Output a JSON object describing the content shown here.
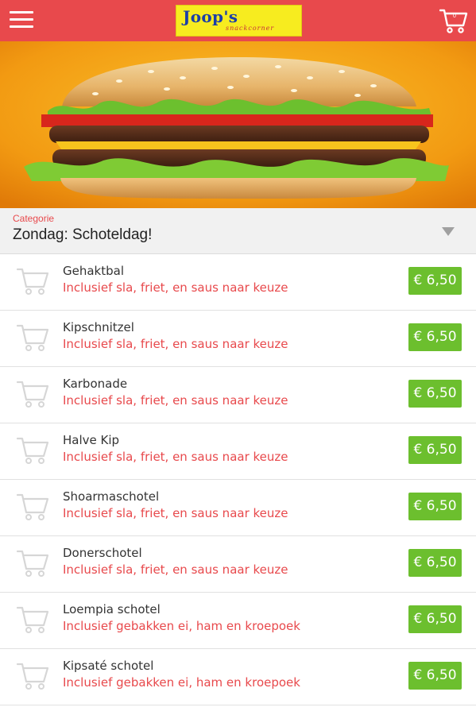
{
  "header": {
    "menu_icon": "hamburger-menu-icon",
    "logo": {
      "name": "Joop's",
      "tagline": "snackcorner"
    },
    "cart": {
      "icon": "shopping-cart-icon",
      "count": "0"
    }
  },
  "colors": {
    "header_bg": "#e8494c",
    "accent_red": "#e8494c",
    "price_green": "#6cbf2e",
    "logo_yellow": "#f7ec1f",
    "logo_blue": "#1b3fa8"
  },
  "hero": {
    "image": "burger-photo"
  },
  "category": {
    "label": "Categorie",
    "selected": "Zondag: Schoteldag!",
    "dropdown_icon": "triangle-down-icon"
  },
  "products": [
    {
      "name": "Gehaktbal",
      "description": "Inclusief sla, friet, en saus naar keuze",
      "price": "€ 6,50"
    },
    {
      "name": "Kipschnitzel",
      "description": "Inclusief sla, friet, en saus naar keuze",
      "price": "€ 6,50"
    },
    {
      "name": "Karbonade",
      "description": "Inclusief sla, friet, en saus naar keuze",
      "price": "€ 6,50"
    },
    {
      "name": "Halve Kip",
      "description": "Inclusief sla, friet, en saus naar keuze",
      "price": "€ 6,50"
    },
    {
      "name": "Shoarmaschotel",
      "description": "Inclusief sla, friet, en saus naar keuze",
      "price": "€ 6,50"
    },
    {
      "name": "Donerschotel",
      "description": "Inclusief sla, friet, en saus naar keuze",
      "price": "€ 6,50"
    },
    {
      "name": "Loempia schotel",
      "description": "Inclusief gebakken ei, ham en kroepoek",
      "price": "€ 6,50"
    },
    {
      "name": "Kipsaté schotel",
      "description": "Inclusief gebakken ei, ham en kroepoek",
      "price": "€ 6,50"
    }
  ]
}
